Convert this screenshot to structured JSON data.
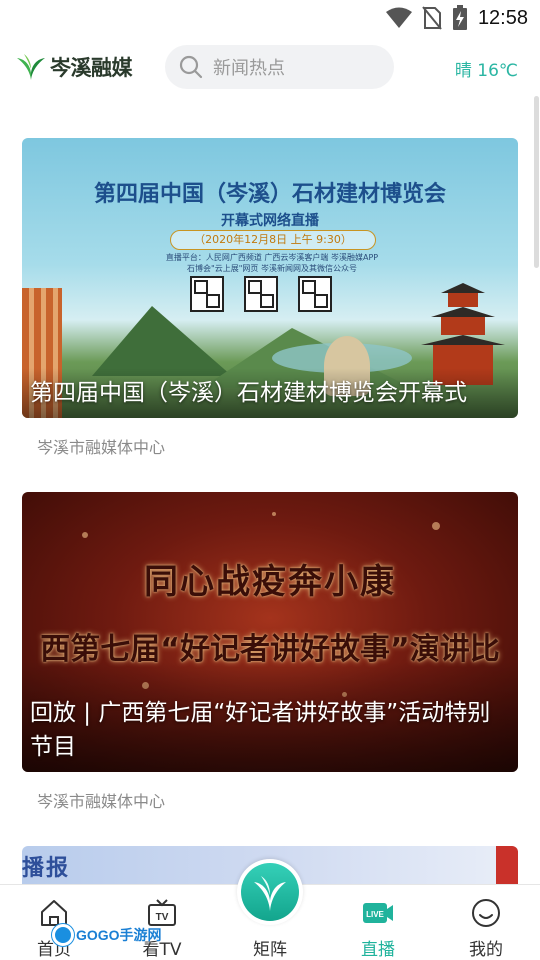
{
  "status_bar": {
    "time": "12:58",
    "icons": [
      "wifi-icon",
      "no-sim-icon",
      "battery-charging-icon"
    ]
  },
  "header": {
    "logo_text": "岑溪融媒",
    "search_placeholder": "新闻热点",
    "weather": "晴 16℃"
  },
  "feed": [
    {
      "title": "第四届中国（岑溪）石材建材博览会开幕式",
      "source": "岑溪市融媒体中心",
      "poster": {
        "headline": "第四届中国（岑溪）石材建材博览会",
        "subheading": "开幕式网络直播",
        "date": "（2020年12月8日 上午 9:30）",
        "platform_line1": "直播平台：人民网广西频道  广西云岑溪客户端  岑溪融媒APP",
        "platform_line2": "石博会\"云上展\"网页  岑溪新闻网及其微信公众号"
      }
    },
    {
      "title": "回放 | 广西第七届“好记者讲好故事”活动特别节目",
      "source": "岑溪市融媒体中心",
      "poster": {
        "headline": "同心战疫奔小康",
        "subheading": "西第七届“好记者讲好故事”演讲比"
      }
    },
    {
      "peek_text": "播报"
    }
  ],
  "bottom_nav": {
    "items": [
      {
        "label": "首页",
        "icon": "home-icon",
        "active": false
      },
      {
        "label": "看TV",
        "icon": "tv-icon",
        "active": false
      },
      {
        "label": "矩阵",
        "icon": "matrix-logo-icon",
        "active": false
      },
      {
        "label": "直播",
        "icon": "live-icon",
        "active": true
      },
      {
        "label": "我的",
        "icon": "smiley-icon",
        "active": false
      }
    ]
  },
  "watermark": "GOGO手游网",
  "colors": {
    "accent": "#20b39c",
    "logo_green": "#3fb34f",
    "search_bg": "#f1f2f4",
    "weather": "#2bb6a3"
  }
}
